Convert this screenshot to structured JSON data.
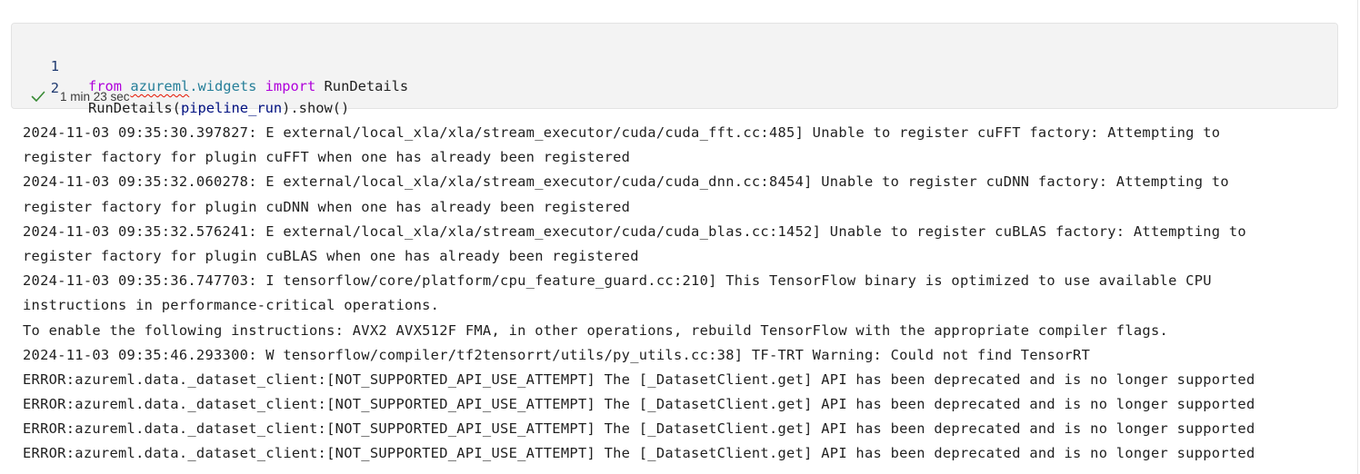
{
  "cell": {
    "lines": [
      {
        "number": "1",
        "tokens": [
          {
            "text": "from",
            "kind": "kw"
          },
          {
            "text": " ",
            "kind": "plain"
          },
          {
            "text": "azureml",
            "kind": "mod"
          },
          {
            "text": ".widgets",
            "kind": "mod"
          },
          {
            "text": " ",
            "kind": "plain"
          },
          {
            "text": "import",
            "kind": "kw"
          },
          {
            "text": " RunDetails",
            "kind": "plain"
          }
        ]
      },
      {
        "number": "2",
        "tokens": [
          {
            "text": "RunDetails(",
            "kind": "plain"
          },
          {
            "text": "pipeline_run",
            "kind": "var"
          },
          {
            "text": ").show()",
            "kind": "plain"
          }
        ]
      }
    ],
    "execution": {
      "status": "success",
      "status_icon": "check-icon",
      "status_color": "#388a34",
      "time": "1 min 23 sec"
    }
  },
  "output": {
    "lines": [
      "2024-11-03 09:35:30.397827: E external/local_xla/xla/stream_executor/cuda/cuda_fft.cc:485] Unable to register cuFFT factory: Attempting to",
      "register factory for plugin cuFFT when one has already been registered",
      "2024-11-03 09:35:32.060278: E external/local_xla/xla/stream_executor/cuda/cuda_dnn.cc:8454] Unable to register cuDNN factory: Attempting to",
      "register factory for plugin cuDNN when one has already been registered",
      "2024-11-03 09:35:32.576241: E external/local_xla/xla/stream_executor/cuda/cuda_blas.cc:1452] Unable to register cuBLAS factory: Attempting to",
      "register factory for plugin cuBLAS when one has already been registered",
      "2024-11-03 09:35:36.747703: I tensorflow/core/platform/cpu_feature_guard.cc:210] This TensorFlow binary is optimized to use available CPU",
      "instructions in performance-critical operations.",
      "To enable the following instructions: AVX2 AVX512F FMA, in other operations, rebuild TensorFlow with the appropriate compiler flags.",
      "2024-11-03 09:35:46.293300: W tensorflow/compiler/tf2tensorrt/utils/py_utils.cc:38] TF-TRT Warning: Could not find TensorRT",
      "ERROR:azureml.data._dataset_client:[NOT_SUPPORTED_API_USE_ATTEMPT] The [_DatasetClient.get] API has been deprecated and is no longer supported",
      "ERROR:azureml.data._dataset_client:[NOT_SUPPORTED_API_USE_ATTEMPT] The [_DatasetClient.get] API has been deprecated and is no longer supported",
      "ERROR:azureml.data._dataset_client:[NOT_SUPPORTED_API_USE_ATTEMPT] The [_DatasetClient.get] API has been deprecated and is no longer supported",
      "ERROR:azureml.data._dataset_client:[NOT_SUPPORTED_API_USE_ATTEMPT] The [_DatasetClient.get] API has been deprecated and is no longer supported"
    ]
  },
  "colors": {
    "keyword": "#af00db",
    "module": "#267f99",
    "variable": "#001080",
    "line_number": "#1f3a70",
    "cell_background": "#f3f3f3"
  }
}
